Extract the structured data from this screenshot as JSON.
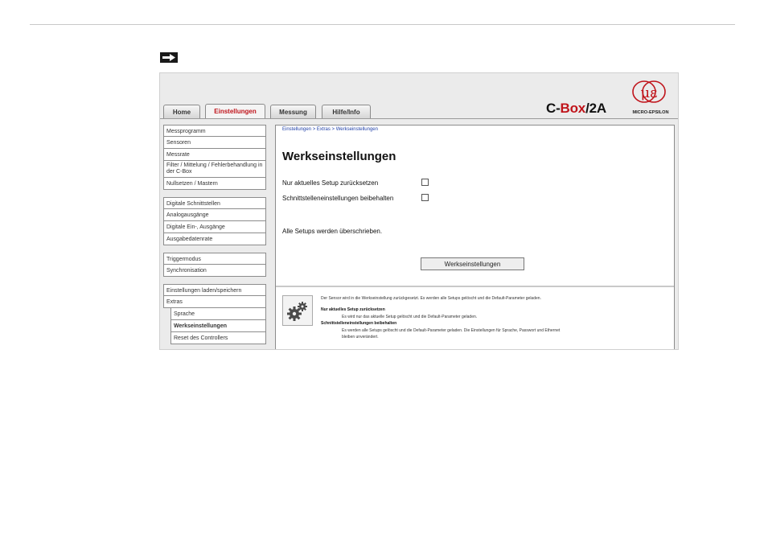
{
  "tabs": [
    {
      "label": "Home",
      "active": false
    },
    {
      "label": "Einstellungen",
      "active": true
    },
    {
      "label": "Messung",
      "active": false
    },
    {
      "label": "Hilfe/Info",
      "active": false
    }
  ],
  "brand": {
    "prefix": "C-",
    "highlight": "Box",
    "suffix": "/2A",
    "logo_text": "MICRO-EPSILON",
    "logo_mark": "μɛ"
  },
  "sidebar": {
    "group1": [
      "Messprogramm",
      "Sensoren",
      "Messrate",
      "Filter / Mittelung / Fehlerbehandlung in der C-Box",
      "Nullsetzen / Mastern"
    ],
    "group2": [
      "Digitale Schnittstellen",
      "Analogausgänge",
      "Digitale Ein-, Ausgänge",
      "Ausgabedatenrate"
    ],
    "group3": [
      "Triggermodus",
      "Synchronisation"
    ],
    "group4": [
      "Einstellungen laden/speichern",
      "Extras"
    ],
    "group4_sub": [
      "Sprache",
      "Werkseinstellungen",
      "Reset des Controllers"
    ],
    "selected": "Werkseinstellungen"
  },
  "content": {
    "breadcrumb": "Einstellungen > Extras > Werkseinstellungen",
    "title": "Werkseinstellungen",
    "option1": "Nur aktuelles Setup zurücksetzen",
    "option2": "Schnittstelleneinstellungen beibehalten",
    "option1_checked": false,
    "option2_checked": false,
    "info": "Alle Setups werden überschrieben.",
    "button": "Werkseinstellungen"
  },
  "help": {
    "intro": "Der Sensor wird in die Werkseinstellung zurückgesetzt. Es werden alle Setups gelöscht und die Default-Parameter geladen.",
    "h1": "Nur aktuelles Setup zurücksetzen",
    "t1": "Es wird nur das aktuelle Setup gelöscht und die Default-Parameter geladen.",
    "h2": "Schnittstelleneinstellungen beibehalten",
    "t2a": "Es werden alle Setups gelöscht und die Default-Parameter geladen. Die Einstellungen für Sprache, Passwort und Ethernet",
    "t2b": "bleiben unverändert."
  },
  "colors": {
    "accent_red": "#c0141b",
    "link_blue": "#1f3fa8"
  }
}
